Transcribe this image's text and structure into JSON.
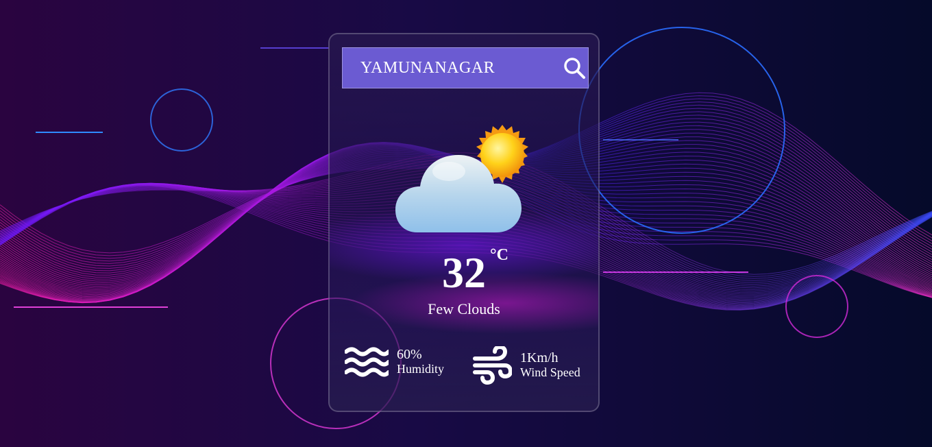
{
  "search": {
    "city_value": "YAMUNANAGAR",
    "location_icon": "map-pin-icon",
    "search_icon": "search-icon"
  },
  "weather": {
    "icon": "partly-cloudy-icon",
    "temperature": "32",
    "unit": "°C",
    "description": "Few Clouds"
  },
  "details": {
    "humidity": {
      "value": "60%",
      "label": "Humidity",
      "icon": "waves-icon"
    },
    "wind": {
      "value": "1Km/h",
      "label": "Wind Speed",
      "icon": "wind-icon"
    }
  },
  "colors": {
    "search_bar": "#6b5bd2",
    "background_dark": "#0b0630",
    "accent_magenta": "#e020d0",
    "accent_blue": "#2a4dff"
  }
}
